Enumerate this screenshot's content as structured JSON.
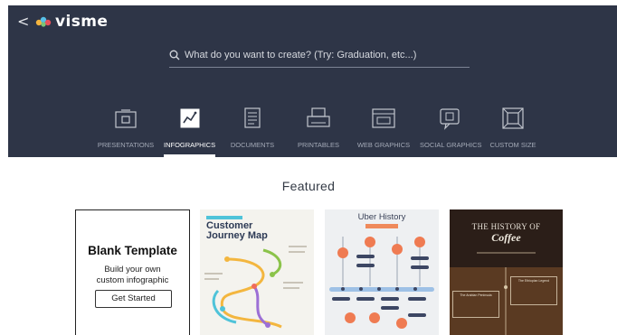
{
  "header": {
    "back_glyph": "<",
    "logo_text": "visme",
    "logo_icon": "visme-logo-icon",
    "background": "#2e3547"
  },
  "search": {
    "placeholder": "What do you want to create? (Try: Graduation, etc...)",
    "icon": "search-icon"
  },
  "categories": [
    {
      "label": "PRESENTATIONS",
      "icon": "presentation-icon",
      "active": false
    },
    {
      "label": "INFOGRAPHICS",
      "icon": "infographic-chart-icon",
      "active": true
    },
    {
      "label": "DOCUMENTS",
      "icon": "documents-icon",
      "active": false
    },
    {
      "label": "PRINTABLES",
      "icon": "printer-icon",
      "active": false
    },
    {
      "label": "WEB GRAPHICS",
      "icon": "web-browser-icon",
      "active": false
    },
    {
      "label": "SOCIAL GRAPHICS",
      "icon": "social-share-icon",
      "active": false
    },
    {
      "label": "CUSTOM SIZE",
      "icon": "resize-frame-icon",
      "active": false
    }
  ],
  "featured": {
    "heading": "Featured",
    "blank": {
      "title": "Blank Template",
      "subtitle_line1": "Build your own",
      "subtitle_line2": "custom infographic",
      "button": "Get Started"
    },
    "templates": [
      {
        "title_line1": "Customer",
        "title_line2": "Journey Map"
      },
      {
        "title": "Uber History"
      },
      {
        "title": "THE HISTORY OF",
        "subtitle": "Coffee",
        "box1": "The Ethiopian Legend",
        "box2": "The Arabian Peninsula"
      }
    ]
  }
}
